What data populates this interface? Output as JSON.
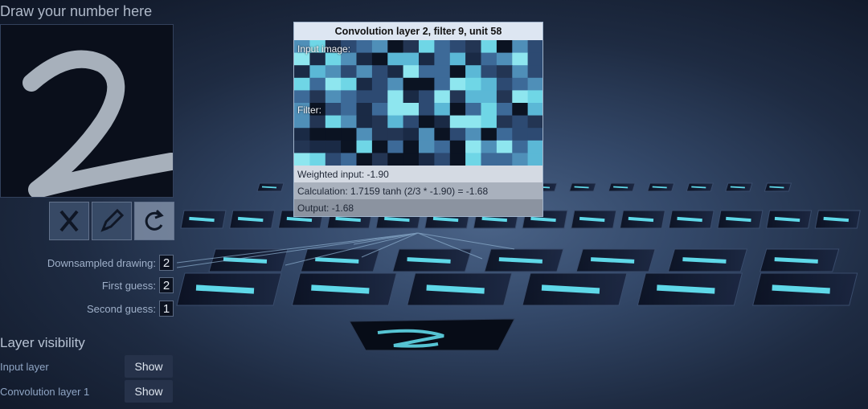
{
  "draw": {
    "title": "Draw your number here",
    "tools": [
      {
        "name": "clear",
        "icon": "clear-x-icon"
      },
      {
        "name": "pencil",
        "icon": "pencil-icon"
      },
      {
        "name": "redo",
        "icon": "redo-icon"
      }
    ]
  },
  "outputs": {
    "downsampled_label": "Downsampled drawing:",
    "downsampled_value": "2",
    "first_label": "First guess:",
    "first_value": "2",
    "second_label": "Second guess:",
    "second_value": "1"
  },
  "layers": {
    "title": "Layer visibility",
    "items": [
      {
        "label": "Input layer",
        "button": "Show"
      },
      {
        "label": "Convolution layer 1",
        "button": "Show"
      }
    ]
  },
  "tooltip": {
    "title": "Convolution layer 2, filter 9, unit 58",
    "input_label": "Input image:",
    "filter_label": "Filter:",
    "weighted": "Weighted input: -1.90",
    "calculation": "Calculation: 1.7159 tanh (2/3 * -1.90) = -1.68",
    "output": "Output: -1.68"
  },
  "colors": {
    "accent_cyan": "#5fd8e8",
    "panel_dark": "#0a0f1b"
  }
}
